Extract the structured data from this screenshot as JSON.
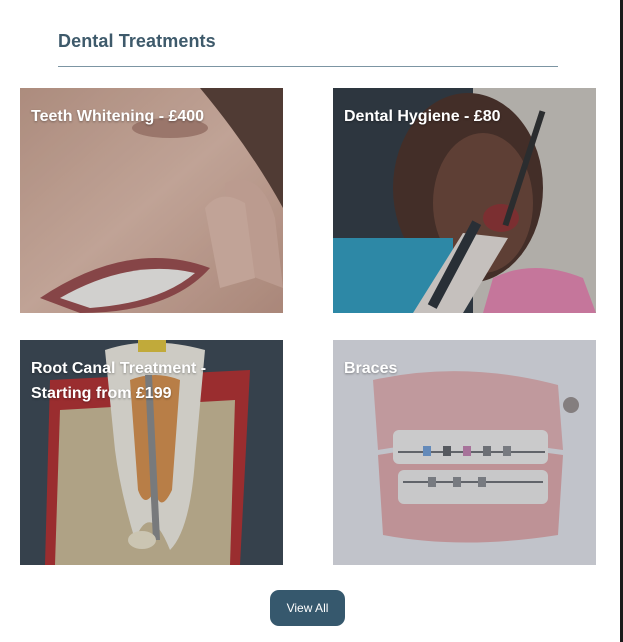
{
  "section": {
    "title": "Dental Treatments"
  },
  "cards": [
    {
      "label": "Teeth Whitening - £400",
      "image": "smiling-woman-photo"
    },
    {
      "label": "Dental Hygiene - £80",
      "image": "dental-cleaning-photo"
    },
    {
      "label": "Root Canal Treatment - Starting from £199",
      "image": "tooth-cross-section-illustration"
    },
    {
      "label": "Braces",
      "image": "dental-model-with-braces-photo"
    }
  ],
  "view_all": {
    "label": "View All"
  },
  "colors": {
    "title": "#3e5a6b",
    "rule": "#7c95a3",
    "button": "#36586d",
    "card_text": "#ffffff"
  }
}
